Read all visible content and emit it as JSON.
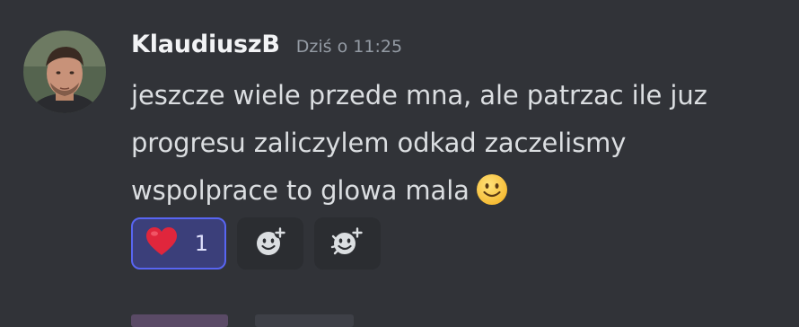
{
  "message": {
    "author": "KlaudiuszB",
    "timestamp": "Dziś o 11:25",
    "lines": [
      "jeszcze wiele przede mna, ale patrzac ile juz",
      "progresu zaliczylem odkad zaczelismy",
      "wspolprace to glowa mala"
    ],
    "emoji": "slightly-smiling-face-icon",
    "avatar": "user-avatar"
  },
  "reactions": [
    {
      "emoji": "red-heart-icon",
      "count": "1",
      "active": true
    }
  ],
  "actions": {
    "add_reaction": "add-reaction-icon",
    "add_super_reaction": "add-super-reaction-icon"
  },
  "colors": {
    "background": "#313338",
    "text": "#dbdee1",
    "muted": "#949ba4",
    "accent": "#5865f2",
    "reaction_bg": "#3b3f7a"
  }
}
